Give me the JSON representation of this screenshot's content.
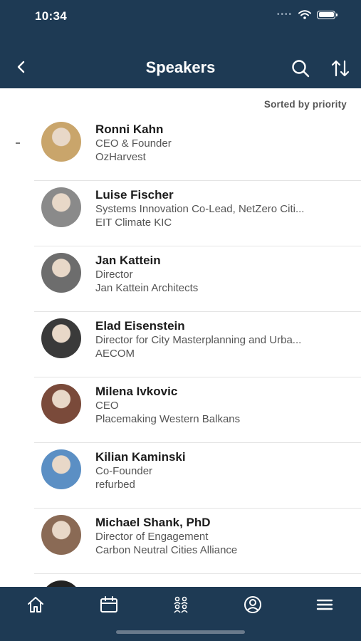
{
  "status": {
    "time": "10:34"
  },
  "header": {
    "title": "Speakers"
  },
  "sort_label": "Sorted by priority",
  "speakers": [
    {
      "name": "Ronni Kahn",
      "role": "CEO & Founder",
      "org": "OzHarvest",
      "avatar_color": "#c9a56b"
    },
    {
      "name": "Luise Fischer",
      "role": "Systems Innovation Co-Lead, NetZero Citi...",
      "org": "EIT Climate KIC",
      "avatar_color": "#8a8a8a"
    },
    {
      "name": "Jan Kattein",
      "role": "Director",
      "org": "Jan Kattein Architects",
      "avatar_color": "#6d6d6d"
    },
    {
      "name": "Elad Eisenstein",
      "role": "Director for City Masterplanning and Urba...",
      "org": "AECOM",
      "avatar_color": "#3a3a3a"
    },
    {
      "name": "Milena Ivkovic",
      "role": "CEO",
      "org": "Placemaking Western Balkans",
      "avatar_color": "#7a4a3a"
    },
    {
      "name": "Kilian Kaminski",
      "role": "Co-Founder",
      "org": "refurbed",
      "avatar_color": "#5b8fc4"
    },
    {
      "name": "Michael Shank, PhD",
      "role": "Director of Engagement",
      "org": "Carbon Neutral Cities Alliance",
      "avatar_color": "#8a6a55"
    }
  ],
  "tabs": [
    {
      "id": "home",
      "icon": "home-icon"
    },
    {
      "id": "calendar",
      "icon": "calendar-icon"
    },
    {
      "id": "people",
      "icon": "people-icon"
    },
    {
      "id": "profile",
      "icon": "profile-icon"
    },
    {
      "id": "menu",
      "icon": "menu-icon"
    }
  ],
  "colors": {
    "header_bg": "#1e3a54",
    "tabbar_bg": "#1e3a54"
  }
}
